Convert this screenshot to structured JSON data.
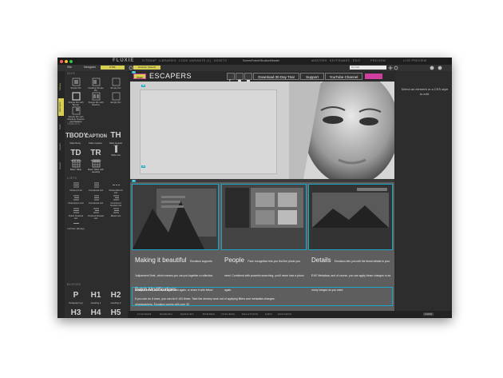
{
  "window": {
    "brand": "FLUXIE",
    "document": "ScreenFrameStructureMaster"
  },
  "top_nav": [
    "SITEMAP",
    "LIBRARIES",
    "CODE",
    "VARIANTS (1)",
    "ASSETS",
    "MASTERS",
    "KEYFRAMES",
    "EDIT",
    "PREVIEW",
    "LIVE PREVIEW"
  ],
  "panel_tabs": [
    "Site",
    "Navigator"
  ],
  "toolbar": {
    "tab_a": "HTML",
    "tab_b": "Desktop (Select)",
    "search_placeholder": "Normal",
    "zoom": "100%"
  },
  "vertical_tabs": [
    "Library",
    "Elements",
    "Style",
    "Layers",
    "Assets"
  ],
  "sections": {
    "divs": "DIVS",
    "tables": "TABLES",
    "lists": "LISTS",
    "blocks": "BLOCKS"
  },
  "div_tiles": [
    "Simple Div",
    "Floating Simple Div",
    "Empty Div",
    "Simple Div with Border",
    "Simple Div with Flexbox",
    "Empty Div",
    "Simple Div with Absolute Position and Relative"
  ],
  "table_tiles": [
    {
      "glyph": "TBODY",
      "label": "Table Body"
    },
    {
      "glyph": "CAPTION",
      "label": "Table Caption"
    },
    {
      "glyph": "TH",
      "label": "Table Header Cell"
    },
    {
      "glyph": "TD",
      "label": "Table Data"
    },
    {
      "glyph": "TR",
      "label": "Table Row"
    },
    {
      "glyph": "",
      "label": "Table Col"
    },
    {
      "glyph": "",
      "label": "Basic Table"
    },
    {
      "glyph": "",
      "label": "Basic Table with Heading"
    }
  ],
  "list_tiles": [
    "Ordered List",
    "Unordered List",
    "Ordered/Horiz List",
    "Description List",
    "Unordered List",
    "Unordered Nested List",
    "Dutch Ordered List",
    "Ordered Nested List",
    "Mixed List",
    "List Item (Empty)"
  ],
  "block_tiles": [
    "P",
    "H1",
    "H2",
    "H3",
    "H4",
    "H5"
  ],
  "block_labels": [
    "Paragraph (p)",
    "Heading 1",
    "Heading 2"
  ],
  "canvas": {
    "logo_badge": "logo",
    "site_name": "ESCAPERS",
    "nav_links": [
      "Download 30 Day Trial",
      "Support",
      "YouTube Channel"
    ],
    "columns": [
      {
        "heading": "Making it beautiful",
        "body": "Emulsion supports 'Adjustment Sets', which means you can put together a collection of Adjustments, and use it again and again, or share it with fellow photographers. Emulsion comes with over 30"
      },
      {
        "heading": "People",
        "body": "Face recognition lets you find the photo you need. Combined with powerful searching, you'll never lose a photo again."
      },
      {
        "heading": "Details",
        "body": "Emulsion lets you edit the finest details in your EXIF Metadata, and of course, you can apply those changes to as many images as you want."
      }
    ],
    "batch_heading": "Batch Modifications",
    "batch_body": "If you can do it once, you can do it 100 times. Take the donkey work out of applying filters and metadata changes."
  },
  "right_hint": "Select an element or a CSS style to edit.",
  "bottom_nav": [
    "FOUNDER",
    "PADDING",
    "MARGINS",
    "BORDER",
    "TOOLBAR",
    "RELATIONS",
    "GRID",
    "MASTERS"
  ],
  "bottom_right": "100%",
  "colors": {
    "accent_yellow": "#d7cf52",
    "tag_cyan": "#1aa7c7",
    "tag_pink": "#d03fa0"
  }
}
